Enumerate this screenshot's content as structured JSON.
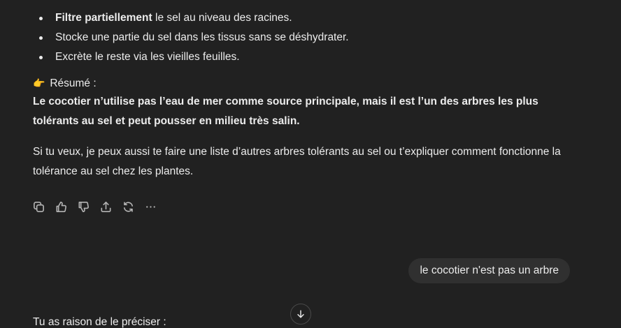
{
  "bullets": [
    {
      "bold": "Filtre partiellement",
      "rest": " le sel au niveau des racines."
    },
    {
      "bold": "",
      "rest": "Stocke une partie du sel dans les tissus sans se déshydrater."
    },
    {
      "bold": "",
      "rest": "Excrète le reste via les vieilles feuilles."
    }
  ],
  "summary": {
    "emoji": "👉",
    "label": "Résumé :",
    "text": "Le cocotier n’utilise pas l’eau de mer comme source principale, mais il est l’un des arbres les plus tolérants au sel et peut pousser en milieu très salin."
  },
  "followup": "Si tu veux, je peux aussi te faire une liste d’autres arbres tolérants au sel ou t’expliquer comment fonctionne la tolérance au sel chez les plantes.",
  "actions": [
    "copy-icon",
    "thumbs-up-icon",
    "thumbs-down-icon",
    "share-icon",
    "regenerate-icon",
    "more-icon"
  ],
  "user_message": "le cocotier n'est pas un arbre",
  "next_reply_start": "Tu as raison de le préciser :"
}
